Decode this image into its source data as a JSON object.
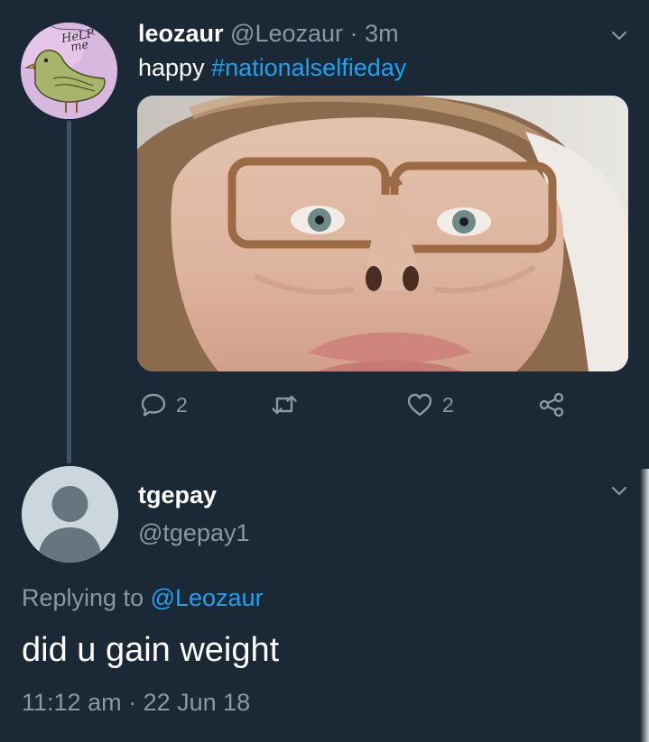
{
  "tweet": {
    "author": {
      "display_name": "leozaur",
      "handle": "@Leozaur",
      "avatar_icon": "bird-drawing-avatar",
      "avatar_text": "HeLP me"
    },
    "separator": "·",
    "time": "3m",
    "text_prefix": "happy ",
    "hashtag": "#nationalselfieday",
    "media_description": "selfie-photo",
    "stats": {
      "replies": "2",
      "retweets": "",
      "likes": "2"
    }
  },
  "reply": {
    "author": {
      "display_name": "tgepay",
      "handle": "@tgepay1",
      "avatar_icon": "default-user-avatar"
    },
    "replying_prefix": "Replying to ",
    "replying_mention": "@Leozaur",
    "text": "did u gain weight",
    "timestamp": "11:12 am · 22 Jun 18"
  },
  "colors": {
    "background": "#1b2836",
    "link": "#1da1f2",
    "secondary_text": "#8899a6",
    "thread_line": "#3d5466"
  }
}
